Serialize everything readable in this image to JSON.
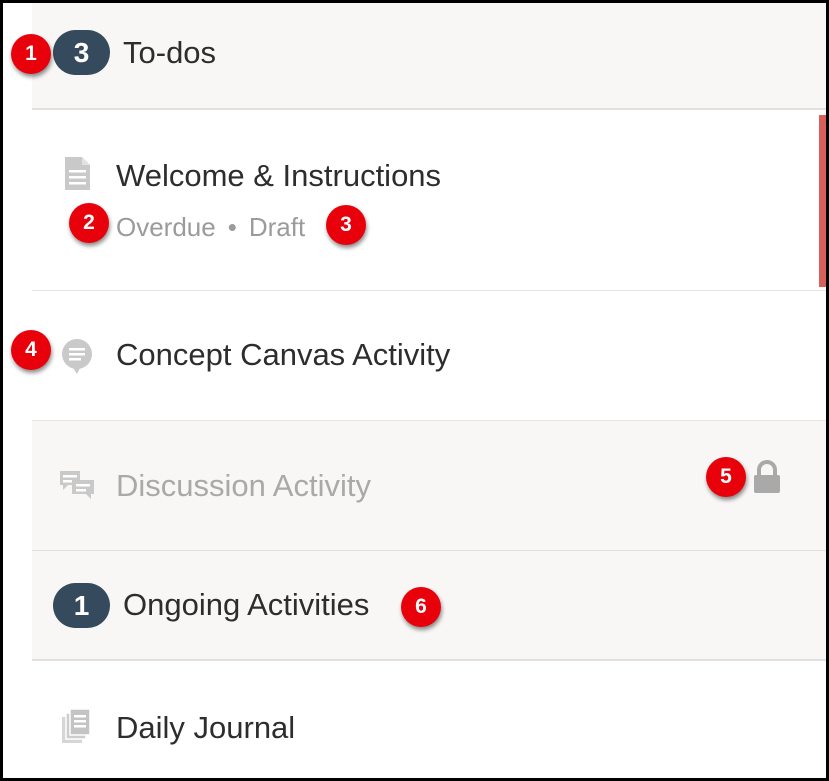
{
  "sections": [
    {
      "count": "3",
      "title": "To-dos",
      "items": [
        {
          "title": "Welcome & Instructions",
          "icon": "document-icon",
          "status": "Overdue",
          "separator": "•",
          "state": "Draft",
          "accent_color": "#d9605a"
        },
        {
          "title": "Concept Canvas Activity",
          "icon": "speech-bubble-icon"
        },
        {
          "title": "Discussion Activity",
          "icon": "discussion-icon",
          "locked": true
        }
      ]
    },
    {
      "count": "1",
      "title": "Ongoing Activities",
      "items": [
        {
          "title": "Daily Journal",
          "icon": "journal-icon"
        }
      ]
    }
  ],
  "callouts": [
    "1",
    "2",
    "3",
    "4",
    "5",
    "6"
  ],
  "colors": {
    "badge": "#354a5c",
    "callout": "#e8000a",
    "header_bg": "#f8f7f6",
    "icon_gray": "#c4c4c4"
  }
}
